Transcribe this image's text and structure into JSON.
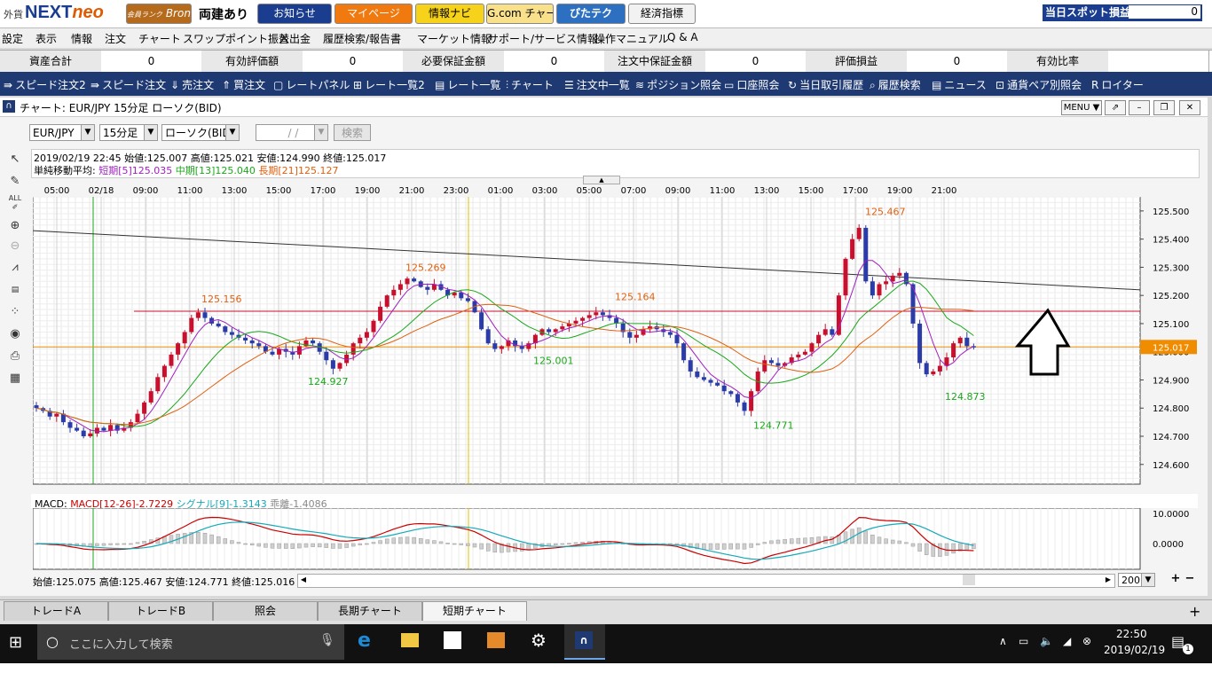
{
  "topbar": {
    "logo_prefix": "外貨",
    "logo_next": "NEXT",
    "logo_neo": "neo",
    "rank_label": "会員ランク",
    "rank": "Bronze",
    "position_mode": "両建あり",
    "buttons": [
      "お知らせ",
      "マイページ",
      "情報ナビ",
      "G.com チャート",
      "ぴたテク",
      "経済指標"
    ],
    "spot_label": "当日スポット損益",
    "spot_value": "0"
  },
  "menu": [
    "設定",
    "表示",
    "情報",
    "注文",
    "チャート",
    "スワップポイント振替",
    "入出金",
    "履歴検索/報告書",
    "マーケット情報",
    "サポート/サービス情報",
    "操作マニュアル",
    "Q & A"
  ],
  "summary": [
    {
      "label": "資産合計",
      "value": "0"
    },
    {
      "label": "有効評価額",
      "value": "0"
    },
    {
      "label": "必要保証金額",
      "value": "0"
    },
    {
      "label": "注文中保証金額",
      "value": "0"
    },
    {
      "label": "評価損益",
      "value": "0"
    },
    {
      "label": "有効比率",
      "value": ""
    }
  ],
  "toolbar": [
    "スピード注文2",
    "スピード注文",
    "売注文",
    "買注文",
    "レートパネル",
    "レート一覧2",
    "レート一覧",
    "チャート",
    "注文中一覧",
    "ポジション照会",
    "口座照会",
    "当日取引履歴",
    "履歴検索",
    "ニュース",
    "通貨ペア別照会",
    "ロイター"
  ],
  "chart_window": {
    "title": "チャート: EUR/JPY 15分足 ローソク(BID)",
    "menu_button": "MENU ▼",
    "pair": "EUR/JPY",
    "timeframe": "15分足",
    "candle_type": "ローソク(BID)",
    "date_placeholder": "/  /",
    "search_button": "検索",
    "ohlc_line": "2019/02/19 22:45  始値:125.007  高値:125.021  安値:124.990  終値:125.017",
    "ma_label": "単純移動平均:",
    "ma_short": "短期[5]125.035",
    "ma_mid": "中期[13]125.040",
    "ma_long": "長期[21]125.127",
    "macd_label": "MACD:",
    "macd_value": "MACD[12-26]-2.7229",
    "signal_value": "シグナル[9]-1.3143",
    "diverge_value": "乖離-1.4086",
    "bottom_ohlc": "始値:125.075   高値:125.467   安値:124.771   終値:125.016",
    "bars_count": "200"
  },
  "chart_data": {
    "type": "candlestick",
    "symbol": "EUR/JPY",
    "x_tick_labels": [
      "05:00",
      "02/18",
      "09:00",
      "11:00",
      "13:00",
      "15:00",
      "17:00",
      "19:00",
      "21:00",
      "23:00",
      "01:00",
      "03:00",
      "05:00",
      "07:00",
      "09:00",
      "11:00",
      "13:00",
      "15:00",
      "17:00",
      "19:00",
      "21:00"
    ],
    "y_tick_labels": [
      "125.500",
      "125.400",
      "125.300",
      "125.200",
      "125.100",
      "125.000",
      "124.900",
      "124.800",
      "124.700",
      "124.600"
    ],
    "ylim": [
      124.53,
      125.55
    ],
    "current_price": "125.017",
    "annotations": [
      {
        "text": "125.156",
        "value": 125.156,
        "kind": "high"
      },
      {
        "text": "124.927",
        "value": 124.927,
        "kind": "low"
      },
      {
        "text": "125.269",
        "value": 125.269,
        "kind": "high"
      },
      {
        "text": "125.001",
        "value": 125.001,
        "kind": "low"
      },
      {
        "text": "125.164",
        "value": 125.164,
        "kind": "high"
      },
      {
        "text": "124.771",
        "value": 124.771,
        "kind": "low"
      },
      {
        "text": "125.467",
        "value": 125.467,
        "kind": "high"
      },
      {
        "text": "124.873",
        "value": 124.873,
        "kind": "low"
      }
    ],
    "horizontal_line": 125.144,
    "trendline": [
      125.43,
      125.22
    ],
    "close_path": [
      124.8,
      124.79,
      124.77,
      124.78,
      124.75,
      124.73,
      124.72,
      124.7,
      124.71,
      124.73,
      124.72,
      124.74,
      124.72,
      124.73,
      124.75,
      124.78,
      124.82,
      124.86,
      124.91,
      124.95,
      124.99,
      125.03,
      125.07,
      125.12,
      125.14,
      125.12,
      125.1,
      125.09,
      125.07,
      125.06,
      125.05,
      125.04,
      125.03,
      125.02,
      125.0,
      124.99,
      125.01,
      125.0,
      124.99,
      125.02,
      125.04,
      125.03,
      125.0,
      124.97,
      124.94,
      124.96,
      124.99,
      125.03,
      125.05,
      125.07,
      125.11,
      125.16,
      125.2,
      125.22,
      125.24,
      125.26,
      125.25,
      125.23,
      125.22,
      125.24,
      125.22,
      125.2,
      125.21,
      125.19,
      125.18,
      125.14,
      125.08,
      125.03,
      125.01,
      125.02,
      125.04,
      125.02,
      125.01,
      125.03,
      125.06,
      125.08,
      125.07,
      125.08,
      125.09,
      125.1,
      125.11,
      125.12,
      125.13,
      125.14,
      125.13,
      125.12,
      125.1,
      125.07,
      125.05,
      125.06,
      125.08,
      125.09,
      125.08,
      125.07,
      125.06,
      125.03,
      124.97,
      124.93,
      124.91,
      124.9,
      124.89,
      124.88,
      124.86,
      124.85,
      124.82,
      124.79,
      124.86,
      124.93,
      124.97,
      124.96,
      124.95,
      124.96,
      124.98,
      124.99,
      125.0,
      125.03,
      125.06,
      125.08,
      125.06,
      125.2,
      125.33,
      125.4,
      125.44,
      125.25,
      125.2,
      125.24,
      125.25,
      125.27,
      125.28,
      125.24,
      125.1,
      124.96,
      124.92,
      124.93,
      124.95,
      124.98,
      125.03,
      125.05,
      125.02,
      125.017
    ]
  },
  "tabs": [
    "トレードA",
    "トレードB",
    "照会",
    "長期チャート",
    "短期チャート"
  ],
  "taskbar": {
    "search_placeholder": "ここに入力して検索",
    "time": "22:50",
    "date": "2019/02/19",
    "notifications": "1"
  }
}
